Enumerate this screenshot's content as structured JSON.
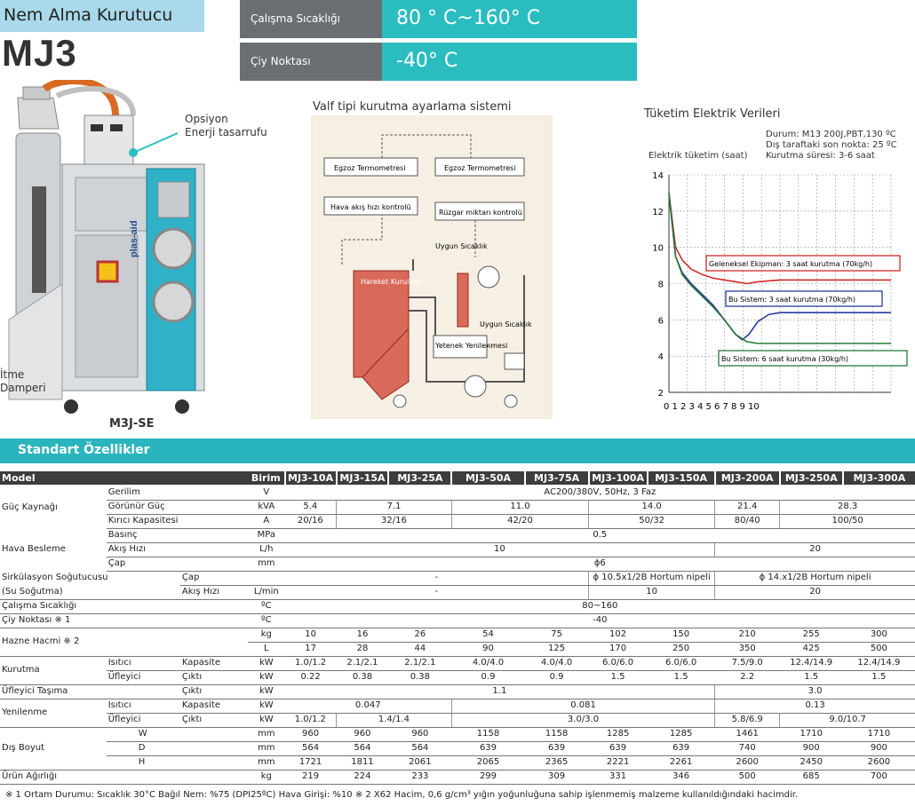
{
  "header": {
    "product_title": "Nem Alma Kurutucu",
    "model": "MJ3",
    "specs": [
      {
        "label": "Çalışma Sıcaklığı",
        "value": "80 ° C~160° C"
      },
      {
        "label": "Çiy Noktası",
        "value": "-40° C"
      }
    ]
  },
  "product_image": {
    "option_label_1": "Opsiyon",
    "option_label_2": "Enerji tasarrufu",
    "damper_label_1": "İtme",
    "damper_label_2": "Damperi",
    "model_label": "M3J-SE",
    "brand_text": "plas-aid"
  },
  "valve_diagram": {
    "title": "Valf tipi kurutma ayarlama sistemi",
    "boxes": [
      "Egzoz Termometresi",
      "Hava akış hızı kontrolü",
      "Egzoz Termometresi",
      "Rüzgar miktarı kontrolü",
      "Hareket Kuruluğu",
      "Yetenek Yenilenmesi"
    ],
    "labels": [
      "Uygun Sıcaklık",
      "Uygun Sıcaklık"
    ]
  },
  "chart_data": {
    "type": "line",
    "title": "Tüketim Elektrik Verileri",
    "ylabel": "Elektrik tüketim (saat)",
    "conditions": [
      "Durum: M13 200J,PBT,130 ºC",
      "Dış taraftaki son nokta: 25 ºC",
      "Kurutma süresi: 3-6 saat"
    ],
    "x_ticks": [
      "0",
      "1",
      "2",
      "3",
      "4",
      "5",
      "6",
      "7",
      "8",
      "9",
      "10"
    ],
    "y_ticks": [
      "2",
      "4",
      "6",
      "8",
      "10",
      "12",
      "14"
    ],
    "xlim": [
      0,
      10
    ],
    "ylim": [
      2,
      14
    ],
    "grid": true,
    "series": [
      {
        "name": "Geleneksel Ekipman: 3 saat kurutma (70kg/h)",
        "color": "#d42a2a",
        "x": [
          0,
          0.3,
          0.6,
          1,
          1.5,
          2,
          2.5,
          3,
          3.5,
          4,
          5,
          6,
          7,
          8,
          9,
          10
        ],
        "y": [
          13,
          10,
          9.3,
          8.8,
          8.5,
          8.3,
          8.2,
          8.1,
          8.0,
          8.1,
          8.2,
          8.2,
          8.2,
          8.2,
          8.2,
          8.2
        ]
      },
      {
        "name": "Bu Sistem: 3 saat kurutma (70kg/h)",
        "color": "#2a3d9e",
        "x": [
          0,
          0.3,
          0.6,
          1,
          1.5,
          2,
          2.5,
          3,
          3.3,
          3.6,
          4,
          4.5,
          5,
          6,
          7,
          8,
          9,
          10
        ],
        "y": [
          13,
          9.5,
          8.6,
          8.0,
          7.4,
          6.8,
          6.0,
          5.2,
          4.9,
          5.2,
          5.9,
          6.3,
          6.4,
          6.4,
          6.4,
          6.4,
          6.4,
          6.4
        ]
      },
      {
        "name": "Bu Sistem: 6 saat kurutma (30kg/h)",
        "color": "#2a7a3a",
        "x": [
          0,
          0.3,
          0.6,
          1,
          1.5,
          2,
          2.5,
          3,
          3.5,
          4,
          5,
          6,
          7,
          8,
          9,
          10
        ],
        "y": [
          13,
          9.5,
          8.5,
          7.9,
          7.3,
          6.7,
          6.0,
          5.2,
          4.8,
          4.7,
          4.7,
          4.7,
          4.7,
          4.7,
          4.7,
          4.7
        ]
      }
    ]
  },
  "table": {
    "section_title": "Standart Özellikler",
    "headers": [
      "Model",
      "Birim",
      "MJ3-10A",
      "MJ3-15A",
      "MJ3-25A",
      "MJ3-50A",
      "MJ3-75A",
      "MJ3-100A",
      "MJ3-150A",
      "MJ3-200A",
      "MJ3-250A",
      "MJ3-300A"
    ],
    "rows": {
      "guc_kaynagi": "Güç Kaynağı",
      "gerilim": "Gerilim",
      "gerilim_u": "V",
      "gerilim_v": "AC200/380V, 50Hz, 3 Faz",
      "gorunur": "Görünür Güç",
      "gorunur_u": "kVA",
      "gorunur_v": [
        "5.4",
        "7.1",
        "11.0",
        "14.0",
        "21.4",
        "28.3"
      ],
      "kirici": "Kırıcı Kapasitesi",
      "kirici_u": "A",
      "kirici_v": [
        "20/16",
        "32/16",
        "42/20",
        "50/32",
        "80/40",
        "100/50"
      ],
      "hava_besleme": "Hava Besleme",
      "basinc": "Basınç",
      "basinc_u": "MPa",
      "basinc_v": "0.5",
      "akis": "Akış Hızı",
      "akis_u": "L/h",
      "akis_v": [
        "10",
        "20"
      ],
      "cap": "Çap",
      "cap_u": "mm",
      "cap_v": "ϕ6",
      "sirk_1": "Sirkülasyon Soğutucusu",
      "sirk_2": "(Su Soğutma)",
      "sirk_cap": "Çap",
      "sirk_cap_v": [
        "-",
        "ϕ 10.5x1/2B Hortum nipeli",
        "ϕ 14.x1/2B Hortum nipeli"
      ],
      "sirk_akis": "Akış Hızı",
      "sirk_akis_u": "L/min",
      "sirk_akis_v": [
        "-",
        "10",
        "20"
      ],
      "calisma": "Çalışma Sıcaklığı",
      "calisma_u": "ºC",
      "calisma_v": "80~160",
      "ciy": "Çiy Noktası ※ 1",
      "ciy_u": "ºC",
      "ciy_v": "-40",
      "hazne": "Hazne Hacmi ※ 2",
      "hazne_kg_u": "kg",
      "hazne_kg": [
        "10",
        "16",
        "26",
        "54",
        "75",
        "102",
        "150",
        "210",
        "255",
        "300"
      ],
      "hazne_l_u": "L",
      "hazne_l": [
        "17",
        "28",
        "44",
        "90",
        "125",
        "170",
        "250",
        "350",
        "425",
        "500"
      ],
      "kurutma": "Kurutma",
      "isitici": "Isıtıcı",
      "kapasite": "Kapasite",
      "isitici_u": "kW",
      "isitici_v": [
        "1.0/1.2",
        "2.1/2.1",
        "2.1/2.1",
        "4.0/4.0",
        "4.0/4.0",
        "6.0/6.0",
        "6.0/6.0",
        "7.5/9.0",
        "12.4/14.9",
        "12.4/14.9"
      ],
      "ufleyici": "Üfleyici",
      "cikti": "Çıktı",
      "ufleyici_u": "kW",
      "ufleyici_v": [
        "0.22",
        "0.38",
        "0.38",
        "0.9",
        "0.9",
        "1.5",
        "1.5",
        "2.2",
        "1.5",
        "1.5"
      ],
      "tasima": "Üfleyici Taşıma",
      "tasima_cikti": "Çıktı",
      "tasima_u": "kW",
      "tasima_v": [
        "1.1",
        "3.0"
      ],
      "yenilenme": "Yenilenme",
      "y_isitici": "Isıtıcı",
      "y_kapasite": "Kapasite",
      "y_isitici_u": "kW",
      "y_isitici_v": [
        "0.047",
        "0.081",
        "0.13"
      ],
      "y_ufleyici": "Üfleyici",
      "y_cikti": "Çıktı",
      "y_ufleyici_u": "kW",
      "y_ufleyici_v": [
        "1.0/1.2",
        "1.4/1.4",
        "3.0/3.0",
        "5.8/6.9",
        "9.0/10.7"
      ],
      "dis_boyut": "Dış Boyut",
      "w": "W",
      "w_u": "mm",
      "w_v": [
        "960",
        "960",
        "960",
        "1158",
        "1158",
        "1285",
        "1285",
        "1461",
        "1710",
        "1710"
      ],
      "d": "D",
      "d_u": "mm",
      "d_v": [
        "564",
        "564",
        "564",
        "639",
        "639",
        "639",
        "639",
        "740",
        "900",
        "900"
      ],
      "h": "H",
      "h_u": "mm",
      "h_v": [
        "1721",
        "1811",
        "2061",
        "2065",
        "2365",
        "2221",
        "2261",
        "2600",
        "2450",
        "2600"
      ],
      "agirlik": "Ürün Ağırlığı",
      "agirlik_u": "kg",
      "agirlik_v": [
        "219",
        "224",
        "233",
        "299",
        "309",
        "331",
        "346",
        "500",
        "685",
        "700"
      ]
    }
  },
  "footnote": "※ 1 Ortam Durumu: Sıcaklık 30°C Bağıl Nem: %75 (DPI25ºC) Hava Girişi: %10   ※ 2 X62 Hacim, 0,6 g/cm³ yığın yoğunluğuna sahip işlenmemiş malzeme kullanıldığındaki hacimdir."
}
